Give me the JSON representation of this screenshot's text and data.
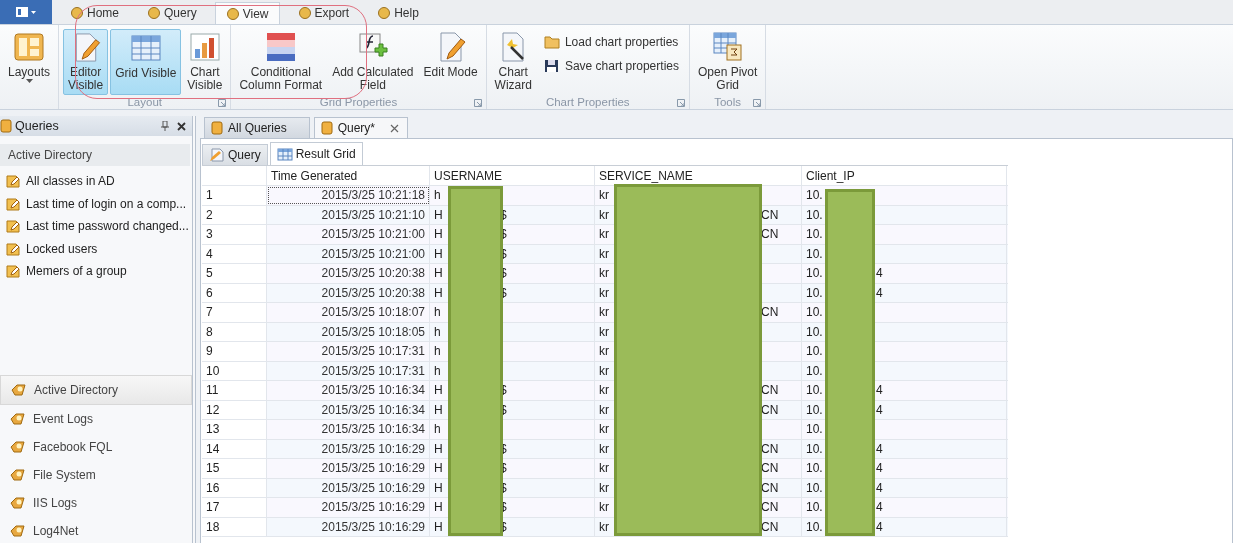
{
  "ribbon_tabs": [
    {
      "label": "Home",
      "selected": false
    },
    {
      "label": "Query",
      "selected": false
    },
    {
      "label": "View",
      "selected": true
    },
    {
      "label": "Export",
      "selected": false
    },
    {
      "label": "Help",
      "selected": false
    }
  ],
  "ribbon_groups": [
    {
      "items": [
        {
          "kind": "layouts",
          "label": "Layouts",
          "dropdown": true,
          "on": false
        }
      ]
    },
    {
      "title": "Layout",
      "items": [
        {
          "kind": "editor",
          "label": "Editor\nVisible",
          "on": true
        },
        {
          "kind": "grid",
          "label": "Grid Visible",
          "on": true
        },
        {
          "kind": "chart",
          "label": "Chart\nVisible",
          "on": false
        }
      ]
    },
    {
      "title": "Grid Properties",
      "items": [
        {
          "kind": "format",
          "label": "Conditional\nColumn Format",
          "on": false
        },
        {
          "kind": "formula",
          "label": "Add Calculated\nField",
          "on": false
        },
        {
          "kind": "edit",
          "label": "Edit Mode",
          "on": false
        }
      ]
    },
    {
      "title": "Chart Properties",
      "items": [
        {
          "kind": "wizard",
          "label": "Chart\nWizard",
          "on": false
        }
      ],
      "small_items": [
        {
          "kind": "folder",
          "label": "Load chart properties"
        },
        {
          "kind": "disk",
          "label": "Save chart properties"
        }
      ]
    },
    {
      "title": "Tools",
      "items": [
        {
          "kind": "pivot",
          "label": "Open Pivot\nGrid",
          "on": false
        }
      ]
    }
  ],
  "queries_panel": {
    "title": "Queries",
    "section": "Active Directory",
    "items": [
      "All classes in AD",
      "Last time of login on a comp...",
      "Last time password changed...",
      "Locked users",
      "Memers of a group"
    ],
    "nav": [
      {
        "label": "Active Directory",
        "selected": true
      },
      {
        "label": "Event Logs",
        "selected": false
      },
      {
        "label": "Facebook FQL",
        "selected": false
      },
      {
        "label": "File System",
        "selected": false
      },
      {
        "label": "IIS Logs",
        "selected": false
      },
      {
        "label": "Log4Net",
        "selected": false
      }
    ]
  },
  "doc_tabs": [
    {
      "label": "All Queries",
      "selected": false,
      "closable": false
    },
    {
      "label": "Query*",
      "selected": true,
      "closable": true
    }
  ],
  "view_tabs": [
    {
      "label": "Query",
      "kind": "query",
      "selected": false
    },
    {
      "label": "Result Grid",
      "kind": "grid",
      "selected": true
    }
  ],
  "table": {
    "columns": [
      "Time Generated",
      "USERNAME",
      "SERVICE_NAME",
      "Client_IP"
    ],
    "rows": [
      {
        "num": "1",
        "time": "2015/3/25 10:21:18",
        "user": "h",
        "service": "kr",
        "ip": "10.",
        "focused": true
      },
      {
        "num": "2",
        "time": "2015/3/25 10:21:10",
        "user": "H",
        "user_end": "$",
        "service": "kr",
        "service_end": "CN",
        "ip": "10.",
        "focused": false
      },
      {
        "num": "3",
        "time": "2015/3/25 10:21:00",
        "user": "H",
        "user_end": "$",
        "service": "kr",
        "service_end": "CN",
        "ip": "10.",
        "focused": false
      },
      {
        "num": "4",
        "time": "2015/3/25 10:21:00",
        "user": "H",
        "user_end": "$",
        "service": "kr",
        "ip": "10.",
        "focused": false
      },
      {
        "num": "5",
        "time": "2015/3/25 10:20:38",
        "user": "H",
        "user_end": "$",
        "service": "kr",
        "ip": "10.",
        "ip_end": "4",
        "focused": false
      },
      {
        "num": "6",
        "time": "2015/3/25 10:20:38",
        "user": "H",
        "user_end": "$",
        "service": "kr",
        "ip": "10.",
        "ip_end": "4",
        "focused": false
      },
      {
        "num": "7",
        "time": "2015/3/25 10:18:07",
        "user": "h",
        "service": "kr",
        "service_end": "CN",
        "ip": "10.",
        "focused": false
      },
      {
        "num": "8",
        "time": "2015/3/25 10:18:05",
        "user": "h",
        "service": "kr",
        "ip": "10.",
        "focused": false
      },
      {
        "num": "9",
        "time": "2015/3/25 10:17:31",
        "user": "h",
        "service": "kr",
        "ip": "10.",
        "focused": false
      },
      {
        "num": "10",
        "time": "2015/3/25 10:17:31",
        "user": "h",
        "service": "kr",
        "ip": "10.",
        "focused": false
      },
      {
        "num": "11",
        "time": "2015/3/25 10:16:34",
        "user": "H",
        "user_end": "$",
        "service": "kr",
        "service_end": "CN",
        "ip": "10.",
        "ip_end": "4",
        "focused": false
      },
      {
        "num": "12",
        "time": "2015/3/25 10:16:34",
        "user": "H",
        "user_end": "$",
        "service": "kr",
        "service_end": "CN",
        "ip": "10.",
        "ip_end": "4",
        "focused": false
      },
      {
        "num": "13",
        "time": "2015/3/25 10:16:34",
        "user": "h",
        "service": "kr",
        "ip": "10.",
        "focused": false
      },
      {
        "num": "14",
        "time": "2015/3/25 10:16:29",
        "user": "H",
        "user_end": "$",
        "service": "kr",
        "service_end": "CN",
        "ip": "10.",
        "ip_end": "4",
        "focused": false
      },
      {
        "num": "15",
        "time": "2015/3/25 10:16:29",
        "user": "H",
        "user_end": "$",
        "service": "kr",
        "service_end": "CN",
        "ip": "10.",
        "ip_end": "4",
        "focused": false
      },
      {
        "num": "16",
        "time": "2015/3/25 10:16:29",
        "user": "H",
        "user_end": "$",
        "service": "kr",
        "service_end": "CN",
        "ip": "10.",
        "ip_end": "4",
        "focused": false
      },
      {
        "num": "17",
        "time": "2015/3/25 10:16:29",
        "user": "H",
        "user_end": "$",
        "service": "kr",
        "service_end": "CN",
        "ip": "10.",
        "ip_end": "4",
        "focused": false
      },
      {
        "num": "18",
        "time": "2015/3/25 10:16:29",
        "user": "H",
        "user_end": "$",
        "service": "kr",
        "service_end": "CN",
        "ip": "10.",
        "ip_end": "4",
        "focused": false
      }
    ]
  }
}
